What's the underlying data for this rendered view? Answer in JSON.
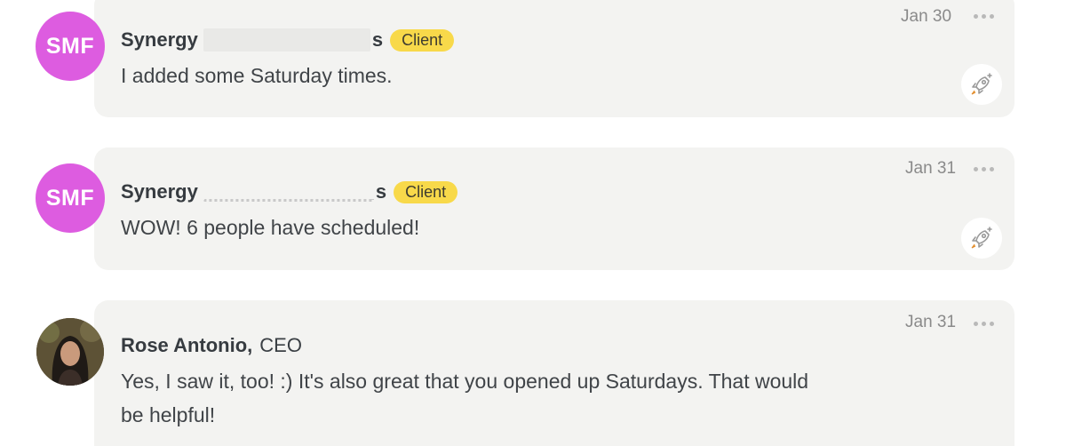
{
  "messages": [
    {
      "avatar_initials": "SMF",
      "sender_name": "Synergy",
      "sender_name_tail": "s",
      "badge": "Client",
      "date": "Jan 30",
      "text": "I added some Saturday times."
    },
    {
      "avatar_initials": "SMF",
      "sender_name": "Synergy",
      "sender_name_tail": "s",
      "badge": "Client",
      "date": "Jan 31",
      "text": "WOW! 6 people have scheduled!"
    },
    {
      "sender_name": "Rose Antonio,",
      "role": "CEO",
      "date": "Jan 31",
      "text_line1": "Yes, I saw it, too! :) It's also great that you opened up Saturdays. That would",
      "text_line2": "be helpful!"
    }
  ],
  "colors": {
    "avatar_bg": "#dd5ce0",
    "badge_bg": "#f8d94a",
    "bubble_bg": "#f3f3f1"
  },
  "icons": {
    "more": "more-dots-icon",
    "react": "rocket-add-reaction-icon"
  }
}
